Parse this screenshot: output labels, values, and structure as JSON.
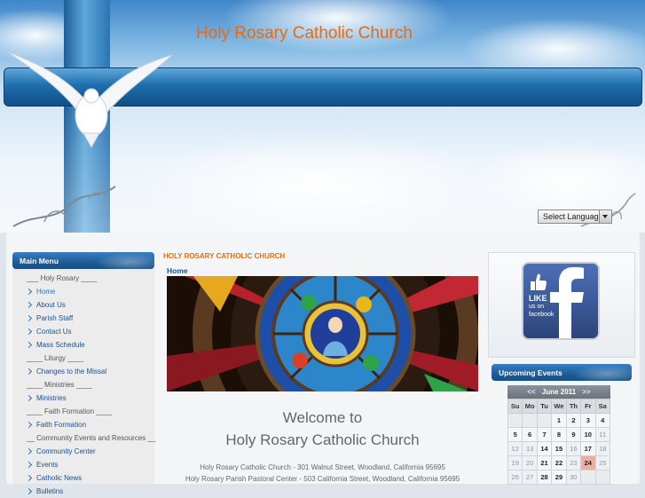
{
  "site": {
    "title": "Holy Rosary Catholic Church"
  },
  "language_select": {
    "label": "Select Language"
  },
  "main_menu": {
    "heading": "Main Menu",
    "items": [
      {
        "type": "sep",
        "label": "___ Holy Rosary ____"
      },
      {
        "type": "link",
        "label": "Home",
        "active": true
      },
      {
        "type": "link",
        "label": "About Us"
      },
      {
        "type": "link",
        "label": "Parish Staff"
      },
      {
        "type": "link",
        "label": "Contact Us"
      },
      {
        "type": "link",
        "label": "Mass Schedule"
      },
      {
        "type": "sep",
        "label": "____ Liturgy ____"
      },
      {
        "type": "link",
        "label": "Changes to the Missal"
      },
      {
        "type": "sep",
        "label": "____ Ministries ____"
      },
      {
        "type": "link",
        "label": "Ministries"
      },
      {
        "type": "sep",
        "label": "____ Faith Formation ____"
      },
      {
        "type": "link",
        "label": "Faith Formation"
      },
      {
        "type": "sep",
        "label": "__ Community Events and Resources __"
      },
      {
        "type": "link",
        "label": "Community Center"
      },
      {
        "type": "link",
        "label": "Events"
      },
      {
        "type": "link",
        "label": "Catholic News"
      },
      {
        "type": "link",
        "label": "Bulletins"
      }
    ]
  },
  "main": {
    "section_title": "HOLY ROSARY CATHOLIC CHURCH",
    "breadcrumb": "Home",
    "welcome_line1": "Welcome to",
    "welcome_line2": "Holy Rosary Catholic Church",
    "address_line1": "Holy Rosary Catholic Church - 301 Walnut Street, Woodland, California 95695",
    "address_line2": "Holy Rosary Parish Pastoral Center - 503 California Street, Woodland, California 95695"
  },
  "facebook": {
    "line1": "LIKE",
    "line2": "us on",
    "line3": "facebook",
    "letter": "f"
  },
  "events": {
    "heading": "Upcoming Events",
    "calendar": {
      "prev": "<<",
      "month": "June 2011",
      "next": ">>",
      "weekdays": [
        "Su",
        "Mo",
        "Tu",
        "We",
        "Th",
        "Fr",
        "Sa"
      ],
      "weeks": [
        [
          "",
          "",
          "",
          "1",
          "2",
          "3",
          "4"
        ],
        [
          "5",
          "6",
          "7",
          "8",
          "9",
          "10",
          "11"
        ],
        [
          "12",
          "13",
          "14",
          "15",
          "16",
          "17",
          "18"
        ],
        [
          "19",
          "20",
          "21",
          "22",
          "23",
          "24",
          "25"
        ],
        [
          "26",
          "27",
          "28",
          "29",
          "30",
          "",
          ""
        ]
      ],
      "bold_days": [
        "1",
        "2",
        "3",
        "4",
        "5",
        "6",
        "7",
        "8",
        "9",
        "10",
        "14",
        "15",
        "17",
        "21",
        "22",
        "24",
        "28",
        "29"
      ],
      "today": "24"
    }
  },
  "colors": {
    "accent": "#e86a10",
    "link": "#1b4f90",
    "header_blue": "#1e6fae"
  }
}
